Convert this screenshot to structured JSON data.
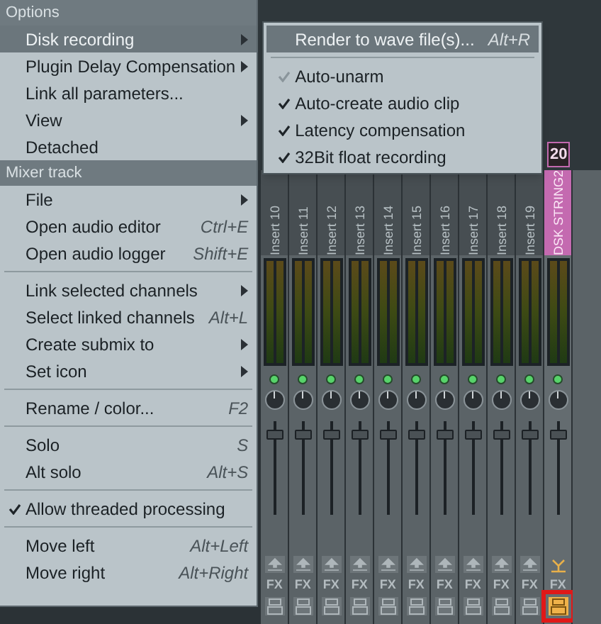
{
  "menu": [
    {
      "kind": "header",
      "label": "Options"
    },
    {
      "kind": "submenu",
      "label": "Disk recording",
      "highlighted": true
    },
    {
      "kind": "submenu",
      "label": "Plugin Delay Compensation",
      "highlighted": false
    },
    {
      "kind": "item",
      "label": "Link all parameters...",
      "highlighted": false
    },
    {
      "kind": "submenu",
      "label": "View",
      "highlighted": false
    },
    {
      "kind": "item",
      "label": "Detached",
      "highlighted": false
    },
    {
      "kind": "header",
      "label": "Mixer track"
    },
    {
      "kind": "submenu",
      "label": "File",
      "highlighted": false
    },
    {
      "kind": "item",
      "label": "Open audio editor",
      "shortcut": "Ctrl+E",
      "highlighted": false
    },
    {
      "kind": "item",
      "label": "Open audio logger",
      "shortcut": "Shift+E",
      "highlighted": false
    },
    {
      "kind": "separator"
    },
    {
      "kind": "submenu",
      "label": "Link selected channels",
      "highlighted": false
    },
    {
      "kind": "item",
      "label": "Select linked channels",
      "shortcut": "Alt+L",
      "highlighted": false
    },
    {
      "kind": "submenu",
      "label": "Create submix to",
      "highlighted": false
    },
    {
      "kind": "submenu",
      "label": "Set icon",
      "highlighted": false
    },
    {
      "kind": "separator"
    },
    {
      "kind": "item",
      "label": "Rename / color...",
      "shortcut": "F2",
      "highlighted": false
    },
    {
      "kind": "separator"
    },
    {
      "kind": "item",
      "label": "Solo",
      "shortcut": "S",
      "highlighted": false
    },
    {
      "kind": "item",
      "label": "Alt solo",
      "shortcut": "Alt+S",
      "highlighted": false
    },
    {
      "kind": "separator"
    },
    {
      "kind": "check",
      "label": "Allow threaded processing",
      "checked": true,
      "highlighted": false
    },
    {
      "kind": "separator"
    },
    {
      "kind": "item",
      "label": "Move left",
      "shortcut": "Alt+Left",
      "highlighted": false
    },
    {
      "kind": "item",
      "label": "Move right",
      "shortcut": "Alt+Right",
      "highlighted": false
    }
  ],
  "submenu": [
    {
      "kind": "item",
      "label": "Render to wave file(s)...",
      "shortcut": "Alt+R",
      "highlighted": true
    },
    {
      "kind": "separator"
    },
    {
      "kind": "check",
      "label": "Auto-unarm",
      "checked": true,
      "disabled": true,
      "highlighted": false
    },
    {
      "kind": "check",
      "label": "Auto-create audio clip",
      "checked": true,
      "disabled": false,
      "highlighted": false
    },
    {
      "kind": "check",
      "label": "Latency compensation",
      "checked": true,
      "disabled": false,
      "highlighted": false
    },
    {
      "kind": "check",
      "label": "32Bit float recording",
      "checked": true,
      "disabled": false,
      "highlighted": false
    }
  ],
  "strips": [
    {
      "name": "Insert 10",
      "fx": "FX",
      "selected": false
    },
    {
      "name": "Insert 11",
      "fx": "FX",
      "selected": false
    },
    {
      "name": "Insert 12",
      "fx": "FX",
      "selected": false
    },
    {
      "name": "Insert 13",
      "fx": "FX",
      "selected": false
    },
    {
      "name": "Insert 14",
      "fx": "FX",
      "selected": false
    },
    {
      "name": "Insert 15",
      "fx": "FX",
      "selected": false
    },
    {
      "name": "Insert 16",
      "fx": "FX",
      "selected": false
    },
    {
      "name": "Insert 17",
      "fx": "FX",
      "selected": false
    },
    {
      "name": "Insert 18",
      "fx": "FX",
      "selected": false
    },
    {
      "name": "Insert 19",
      "fx": "FX",
      "selected": false
    },
    {
      "name": "DSK STRING2",
      "number": "20",
      "fx": "FX",
      "selected": true,
      "save_highlighted": true
    }
  ]
}
